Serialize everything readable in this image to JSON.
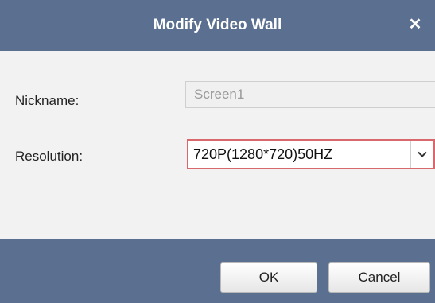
{
  "dialog": {
    "title": "Modify Video Wall",
    "close_icon": "close-icon",
    "accent_color": "#5b6f90"
  },
  "fields": {
    "nickname": {
      "label": "Nickname:",
      "value": "Screen1",
      "disabled": true
    },
    "resolution": {
      "label": "Resolution:",
      "selected": "720P(1280*720)50HZ",
      "icon": "chevron-down-icon",
      "focus_color": "#d8686c"
    }
  },
  "buttons": {
    "ok_label": "OK",
    "cancel_label": "Cancel"
  }
}
